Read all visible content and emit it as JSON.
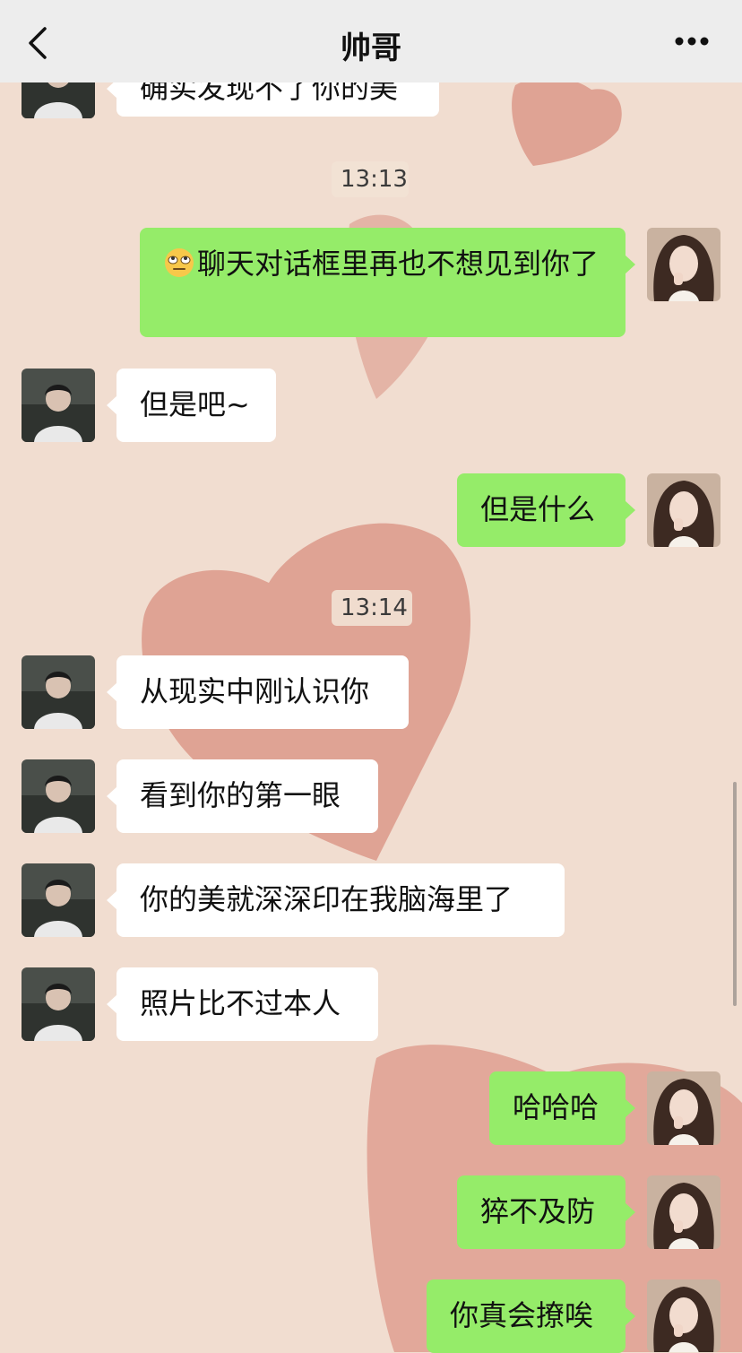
{
  "header": {
    "title": "帅哥"
  },
  "messages": [
    {
      "type": "received",
      "text": "确实发现不了你的美"
    },
    {
      "type": "time",
      "text": "13:13"
    },
    {
      "type": "sent",
      "text": "聊天对话框里再也不想见到你了"
    },
    {
      "type": "received",
      "text": "但是吧~"
    },
    {
      "type": "sent",
      "text": "但是什么"
    },
    {
      "type": "time",
      "text": "13:14"
    },
    {
      "type": "received",
      "text": "从现实中刚认识你"
    },
    {
      "type": "received",
      "text": "看到你的第一眼"
    },
    {
      "type": "received",
      "text": "你的美就深深印在我脑海里了"
    },
    {
      "type": "received",
      "text": "照片比不过本人"
    },
    {
      "type": "sent",
      "text": "哈哈哈"
    },
    {
      "type": "sent",
      "text": "猝不及防"
    },
    {
      "type": "sent",
      "text": "你真会撩唉"
    }
  ],
  "icons": {
    "back": "chevron-left-icon",
    "more": "more-dots-icon",
    "emoji": "eye-roll-emoji-icon"
  },
  "colors": {
    "sent_bubble": "#95ec69",
    "received_bubble": "#ffffff",
    "header_bg": "#ededed",
    "chat_bg": "#f1ddd0",
    "heart": "#d98f80"
  }
}
